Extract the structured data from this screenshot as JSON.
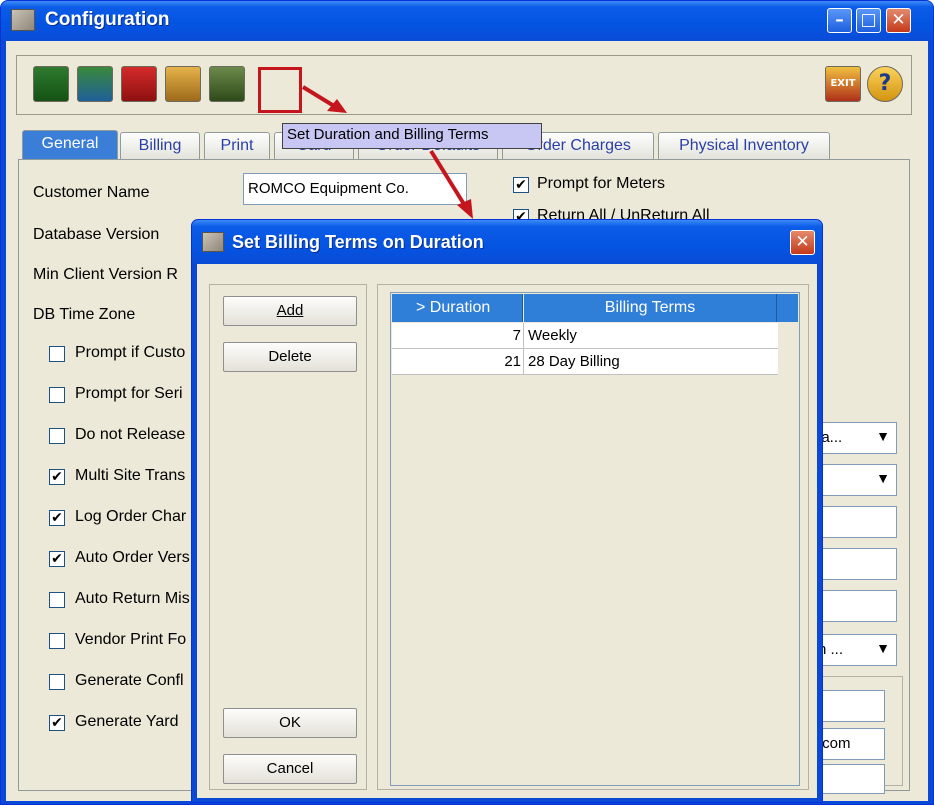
{
  "window": {
    "title": "Configuration"
  },
  "toolbar": {
    "icons": [
      "price-dollar-icon",
      "invoice-dollar-icon",
      "red-c-icon",
      "user-key-icon",
      "calculator-icon",
      "set-duration-icon"
    ],
    "exit_label": "EXIT",
    "help_icon": "help-icon"
  },
  "tooltip": "Set Duration and Billing Terms",
  "tabs": [
    "General",
    "Billing",
    "Print",
    "Card",
    "Order Defaults",
    "Order Charges",
    "Physical Inventory"
  ],
  "general": {
    "customer_name_label": "Customer Name",
    "customer_name_value": "ROMCO Equipment Co.",
    "database_version_label": "Database Version",
    "min_client_label": "Min Client Version R",
    "db_time_zone_label": "DB Time Zone",
    "checkboxes_left": [
      {
        "label": "Prompt if Custo",
        "checked": false
      },
      {
        "label": "Prompt for Seri",
        "checked": false
      },
      {
        "label": "Do not Release",
        "checked": false
      },
      {
        "label": "Multi Site Trans",
        "checked": true
      },
      {
        "label": "Log Order Char",
        "checked": true
      },
      {
        "label": "Auto Order Vers",
        "checked": true
      },
      {
        "label": "Auto Return Mis",
        "checked": false
      },
      {
        "label": "Vendor Print Fo",
        "checked": false
      },
      {
        "label": "Generate Confl",
        "checked": false
      },
      {
        "label": "Generate Yard",
        "checked": true
      }
    ],
    "prompt_for_meters": {
      "label": "Prompt for Meters",
      "checked": true
    },
    "return_all": {
      "label": "Return All / UnReturn All",
      "checked": true
    },
    "combo_1_value": "la...",
    "combo_3_value": "n ...",
    "email_fragment": ".com"
  },
  "dialog": {
    "title": "Set Billing Terms on Duration",
    "add_label": "Add",
    "delete_label": "Delete",
    "ok_label": "OK",
    "cancel_label": "Cancel",
    "columns": [
      "> Duration",
      "Billing Terms"
    ],
    "rows": [
      {
        "duration": "7",
        "terms": "Weekly"
      },
      {
        "duration": "21",
        "terms": "28 Day Billing"
      }
    ]
  },
  "colors": {
    "titlebar": "#0454e2",
    "tab_active": "#3a7ed8",
    "tooltip_bg": "#c8c7f4",
    "arrow": "#c4161c"
  }
}
